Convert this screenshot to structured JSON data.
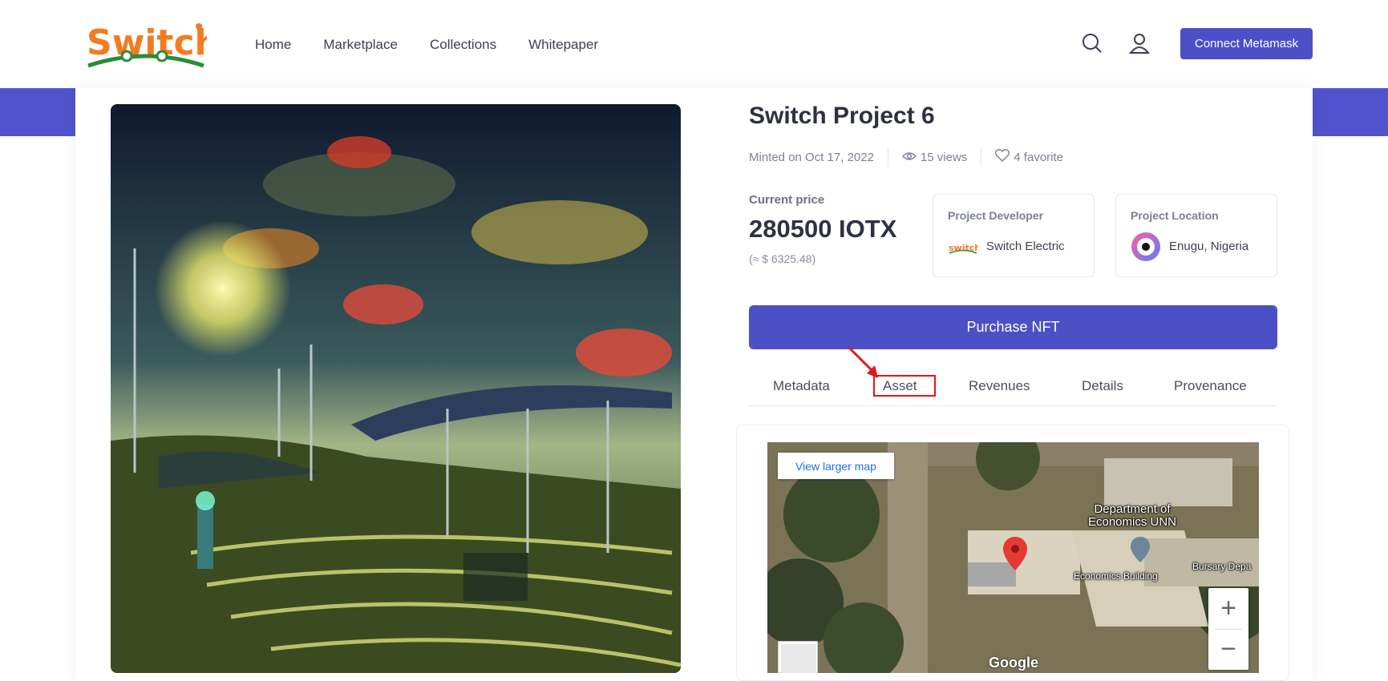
{
  "header": {
    "logo_text": "Switch",
    "nav": [
      "Home",
      "Marketplace",
      "Collections",
      "Whitepaper"
    ],
    "connect_label": "Connect Metamask"
  },
  "nft": {
    "title": "Switch Project 6",
    "minted": "Minted on Oct 17, 2022",
    "views": "15 views",
    "favorites": "4 favorite",
    "price_label": "Current price",
    "price": "280500 IOTX",
    "usd": "(≈ $ 6325.48)",
    "developer_label": "Project Developer",
    "developer_name": "Switch Electric",
    "developer_logo_text": "switch",
    "location_label": "Project Location",
    "location_name": "Enugu, Nigeria",
    "purchase_label": "Purchase NFT"
  },
  "tabs": [
    "Metadata",
    "Asset",
    "Revenues",
    "Details",
    "Provenance"
  ],
  "active_tab": "Asset",
  "map": {
    "link_label": "View larger map",
    "place_name_1": "Department of",
    "place_name_2": "Economics UNN",
    "building_label": "Economics Building",
    "bursary_label": "Bursary Depa",
    "zoom_in": "+",
    "zoom_out": "−",
    "google_label": "Google"
  },
  "colors": {
    "primary": "#4c50c7",
    "highlight": "#e4141b",
    "logo_orange": "#f47b20",
    "logo_green": "#2f8a3a"
  }
}
